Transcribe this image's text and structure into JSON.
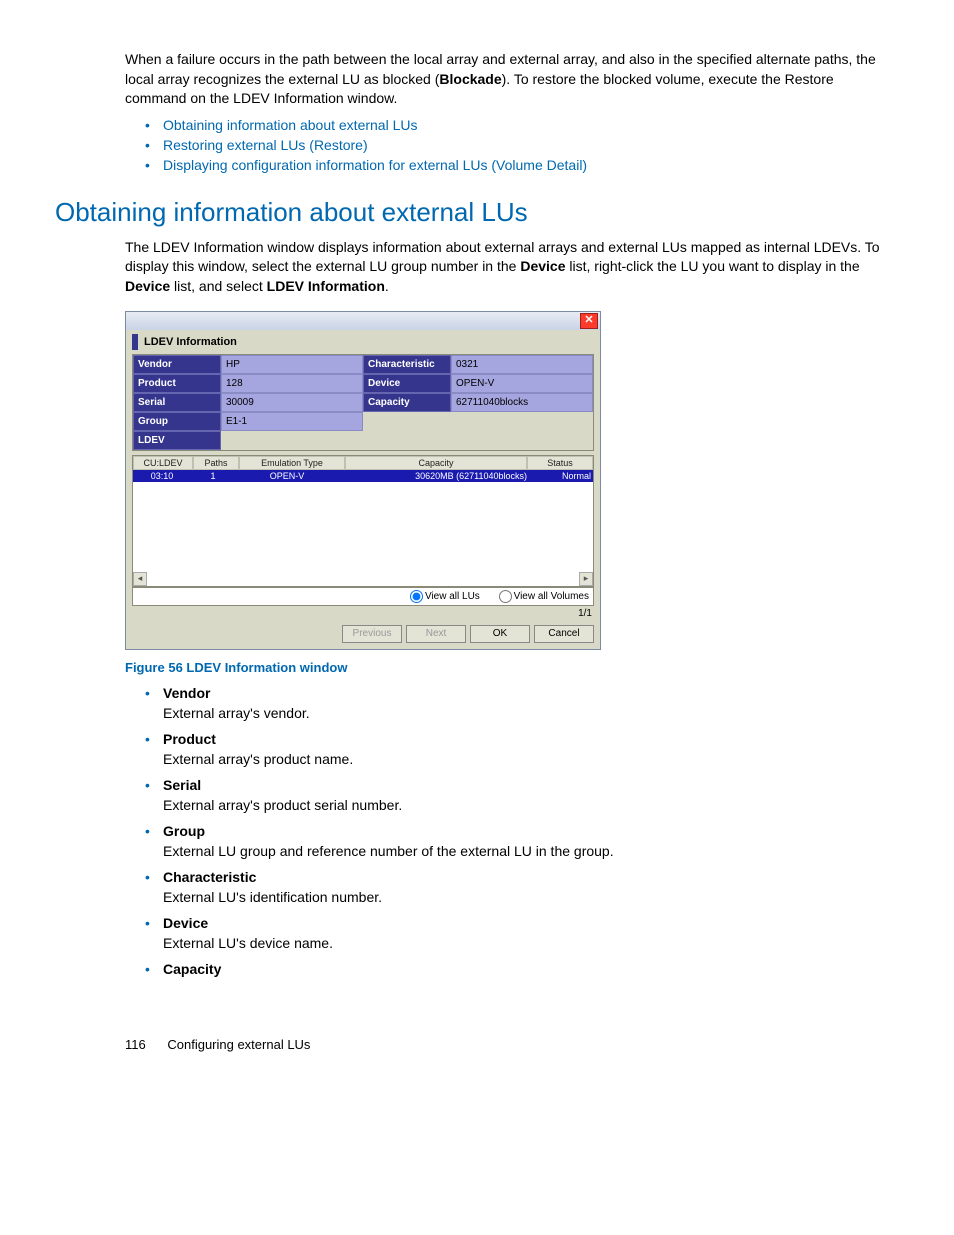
{
  "intro": {
    "text_before_bold": "When a failure occurs in the path between the local array and external array, and also in the specified alternate paths, the local array recognizes the external LU as blocked (",
    "bold1": "Blockade",
    "text_after_bold": "). To restore the blocked volume, execute the Restore command on the LDEV Information window."
  },
  "links": [
    "Obtaining information about external LUs",
    "Restoring external LUs (Restore)",
    "Displaying configuration information for external LUs (Volume Detail)"
  ],
  "heading": "Obtaining information about external LUs",
  "body": {
    "p1a": "The LDEV Information window displays information about external arrays and external LUs mapped as internal LDEVs. To display this window, select the external LU group number in the ",
    "p1b": "Device",
    "p1c": " list, right-click the LU you want to display in the ",
    "p1d": "Device",
    "p1e": " list, and select ",
    "p1f": "LDEV Information",
    "p1g": "."
  },
  "figure_caption": "Figure 56 LDEV Information window",
  "ldev": {
    "title": "LDEV Information",
    "labels": {
      "vendor": "Vendor",
      "product": "Product",
      "serial": "Serial",
      "group": "Group",
      "ldev": "LDEV",
      "characteristic": "Characteristic",
      "device": "Device",
      "capacity": "Capacity"
    },
    "values": {
      "vendor": "HP",
      "product": "128",
      "serial": "30009",
      "group": "E1-1",
      "characteristic": "0321",
      "device": "OPEN-V",
      "capacity": "62711040blocks"
    },
    "table": {
      "headers": {
        "culdev": "CU:LDEV",
        "paths": "Paths",
        "emu": "Emulation Type",
        "cap": "Capacity",
        "status": "Status"
      },
      "row": {
        "culdev": "03:10",
        "paths": "1",
        "emu": "OPEN-V",
        "cap": "30620MB (62711040blocks)",
        "status": "Normal"
      }
    },
    "radios": {
      "all_lus": "View all LUs",
      "all_vols": "View all Volumes"
    },
    "page_ind": "1/1",
    "buttons": {
      "previous": "Previous",
      "next": "Next",
      "ok": "OK",
      "cancel": "Cancel"
    }
  },
  "definitions": [
    {
      "term": "Vendor",
      "desc": "External array's vendor."
    },
    {
      "term": "Product",
      "desc": "External array's product name."
    },
    {
      "term": "Serial",
      "desc": "External array's product serial number."
    },
    {
      "term": "Group",
      "desc": "External LU group and reference number of the external LU in the group."
    },
    {
      "term": "Characteristic",
      "desc": "External LU's identification number."
    },
    {
      "term": "Device",
      "desc": "External LU's device name."
    },
    {
      "term": "Capacity",
      "desc": ""
    }
  ],
  "footer": {
    "page": "116",
    "section": "Configuring external LUs"
  }
}
